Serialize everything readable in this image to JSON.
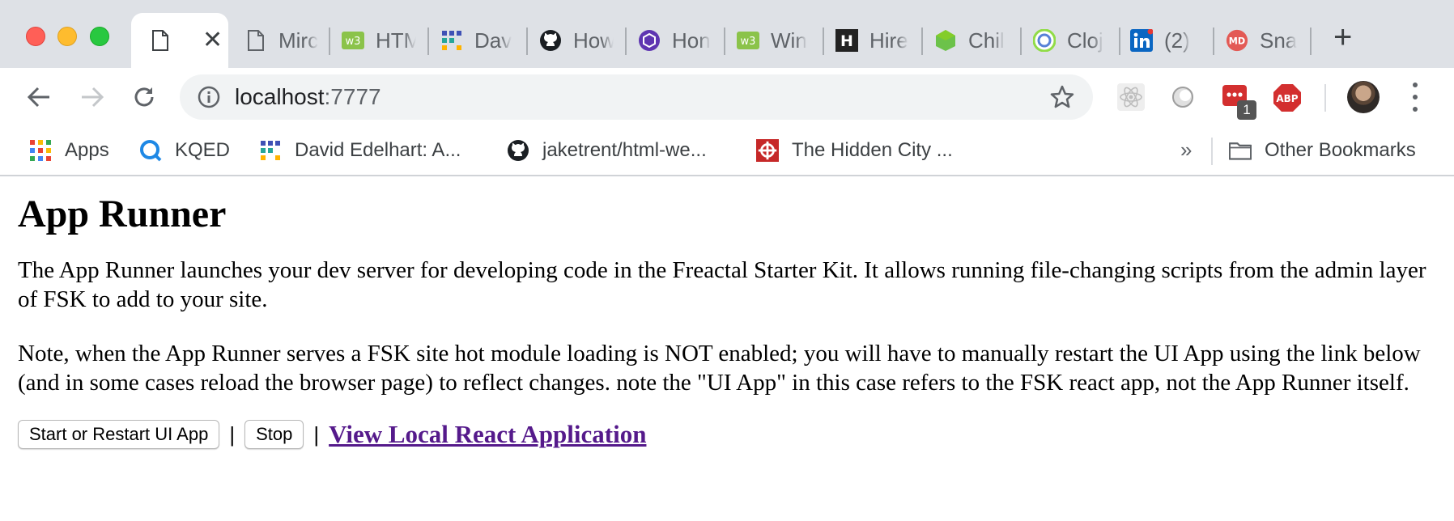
{
  "tabs": [
    {
      "title": "",
      "icon": "document-icon",
      "active": true
    },
    {
      "title": "Mirc",
      "icon": "document-icon"
    },
    {
      "title": "HTM",
      "icon": "w3c-icon"
    },
    {
      "title": "Dav",
      "icon": "grid-icon"
    },
    {
      "title": "How",
      "icon": "github-icon"
    },
    {
      "title": "Hon",
      "icon": "hex-icon"
    },
    {
      "title": "Win",
      "icon": "w3c-icon"
    },
    {
      "title": "Hire",
      "icon": "h-icon"
    },
    {
      "title": "Chil",
      "icon": "node-icon"
    },
    {
      "title": "Cloj",
      "icon": "clojure-icon"
    },
    {
      "title": "(2)",
      "icon": "linkedin-icon"
    },
    {
      "title": "Sna",
      "icon": "md-icon"
    }
  ],
  "toolbar": {
    "url_host": "localhost",
    "url_port": ":7777",
    "ext_badge": "1",
    "abp_label": "ABP"
  },
  "bookmarks": {
    "items": [
      {
        "label": "Apps",
        "icon": "apps-grid-icon"
      },
      {
        "label": "KQED",
        "icon": "kqed-icon"
      },
      {
        "label": "David Edelhart: A...",
        "icon": "grid-icon"
      },
      {
        "label": "jaketrent/html-we...",
        "icon": "github-icon"
      },
      {
        "label": "The Hidden City ...",
        "icon": "hidden-city-icon"
      }
    ],
    "overflow": "»",
    "other_label": "Other Bookmarks"
  },
  "page": {
    "title": "App Runner",
    "intro": "The App Runner launches your dev server for developing code in the Freactal Starter Kit. It allows running file-changing scripts from the admin layer of FSK to add to your site.",
    "note": "Note, when the App Runner serves a FSK site hot module loading is NOT enabled; you will have to manually restart the UI App using the link below (and in some cases reload the browser page) to reflect changes. note the \"UI App\" in this case refers to the FSK react app, not the App Runner itself.",
    "start_label": "Start or Restart UI App",
    "separator": "|",
    "stop_label": "Stop",
    "link_label": "View Local React Application"
  }
}
